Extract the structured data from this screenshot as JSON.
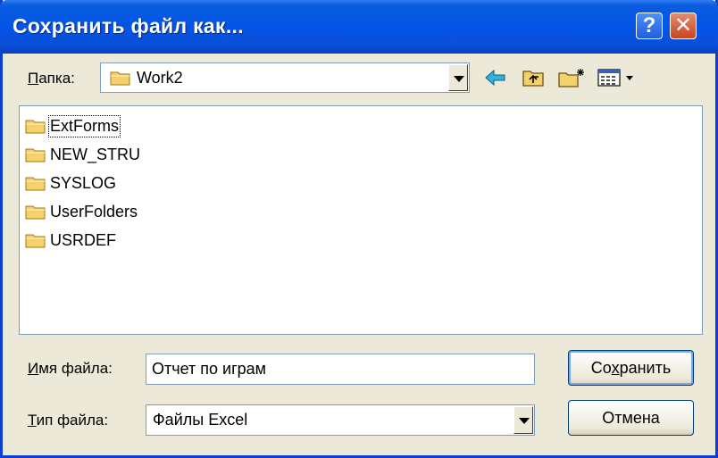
{
  "window": {
    "title": "Сохранить файл как..."
  },
  "titlebar": {
    "help_label": "?",
    "close_label": "✕"
  },
  "folder": {
    "label_access": "П",
    "label_rest": "апка:",
    "current": "Work2"
  },
  "toolbar": {
    "back_icon": "back-arrow-icon",
    "up_icon": "up-folder-icon",
    "new_folder_icon": "new-folder-icon",
    "view_menu_icon": "view-menu-icon"
  },
  "files": [
    {
      "name": "ExtForms"
    },
    {
      "name": "NEW_STRU"
    },
    {
      "name": "SYSLOG"
    },
    {
      "name": "UserFolders"
    },
    {
      "name": "USRDEF"
    }
  ],
  "filename": {
    "label_access": "И",
    "label_rest": "мя файла:",
    "value": "Отчет по играм"
  },
  "filetype": {
    "label_access": "Т",
    "label_rest": "ип файла:",
    "value": "Файлы Excel"
  },
  "buttons": {
    "save_pre": "Со",
    "save_access": "х",
    "save_post": "ранить",
    "cancel": "Отмена"
  },
  "colors": {
    "titlebar": "#0454e6",
    "face": "#ece9d8",
    "folder": "#f5d16b"
  }
}
